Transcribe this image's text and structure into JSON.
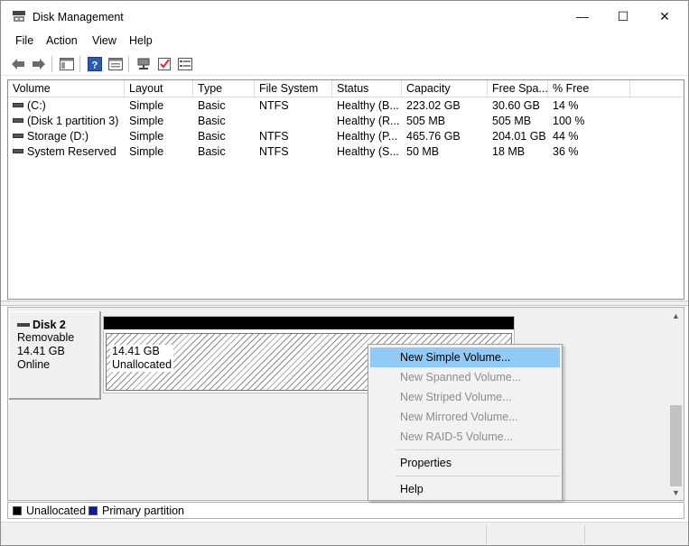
{
  "window": {
    "title": "Disk Management",
    "min_glyph": "—",
    "max_glyph": "☐",
    "close_glyph": "✕"
  },
  "menu": [
    "File",
    "Action",
    "View",
    "Help"
  ],
  "toolbar": {
    "icons": [
      "back-arrow-icon",
      "forward-arrow-icon",
      "console-tree-icon",
      "help-icon",
      "properties-icon",
      "connect-icon",
      "check-icon",
      "volume-list-icon"
    ]
  },
  "volume_table": {
    "headers": [
      "Volume",
      "Layout",
      "Type",
      "File System",
      "Status",
      "Capacity",
      "Free Spa...",
      "% Free"
    ],
    "rows": [
      [
        "(C:)",
        "Simple",
        "Basic",
        "NTFS",
        "Healthy (B...",
        "223.02 GB",
        "30.60 GB",
        "14 %"
      ],
      [
        "(Disk 1 partition 3)",
        "Simple",
        "Basic",
        "",
        "Healthy (R...",
        "505 MB",
        "505 MB",
        "100 %"
      ],
      [
        "Storage (D:)",
        "Simple",
        "Basic",
        "NTFS",
        "Healthy (P...",
        "465.76 GB",
        "204.01 GB",
        "44 %"
      ],
      [
        "System Reserved",
        "Simple",
        "Basic",
        "NTFS",
        "Healthy (S...",
        "50 MB",
        "18 MB",
        "36 %"
      ]
    ]
  },
  "disk": {
    "name": "Disk 2",
    "type": "Removable",
    "size": "14.41 GB",
    "state": "Online",
    "partition": {
      "size": "14.41 GB",
      "label": "Unallocated"
    }
  },
  "legend": [
    {
      "label": "Unallocated",
      "color": "#000000"
    },
    {
      "label": "Primary partition",
      "color": "#0a1a9a"
    }
  ],
  "context_menu": {
    "items": [
      {
        "label": "New Simple Volume...",
        "enabled": true,
        "highlighted": true
      },
      {
        "label": "New Spanned Volume...",
        "enabled": false
      },
      {
        "label": "New Striped Volume...",
        "enabled": false
      },
      {
        "label": "New Mirrored Volume...",
        "enabled": false
      },
      {
        "label": "New RAID-5 Volume...",
        "enabled": false
      },
      {
        "label": "Properties",
        "enabled": true
      },
      {
        "label": "Help",
        "enabled": true
      }
    ]
  },
  "colors": {
    "highlight": "#91c9f7",
    "disabled_text": "#8c8c8c"
  }
}
